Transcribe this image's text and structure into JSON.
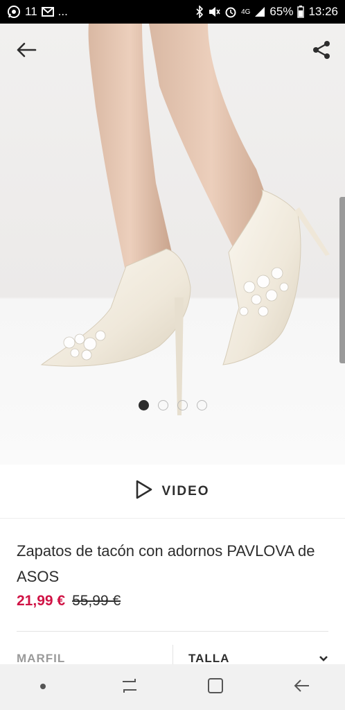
{
  "status_bar": {
    "notif_count": "11",
    "ellipsis": "...",
    "network": "4G",
    "battery": "65%",
    "time": "13:26",
    "icons": [
      "whatsapp-icon",
      "message-icon",
      "gmail-icon",
      "bluetooth-icon",
      "mute-icon",
      "alarm-icon",
      "signal-icon",
      "battery-icon"
    ]
  },
  "hero": {
    "icons": [
      "back-arrow-icon",
      "share-icon"
    ],
    "carousel": {
      "total": 4,
      "active": 1
    }
  },
  "video": {
    "label": "VIDEO",
    "icon": "play-outline-icon"
  },
  "product": {
    "title": "Zapatos de tacón con adornos PAVLOVA de ASOS",
    "price_now": "21,99 €",
    "price_was": "55,99 €",
    "price_color": "#d01345"
  },
  "selectors": {
    "color_label": "MARFIL",
    "size_label": "TALLA",
    "size_icon": "chevron-down-icon"
  },
  "nav": {
    "icons": [
      "dot-icon",
      "recents-icon",
      "home-icon",
      "back-icon"
    ]
  }
}
